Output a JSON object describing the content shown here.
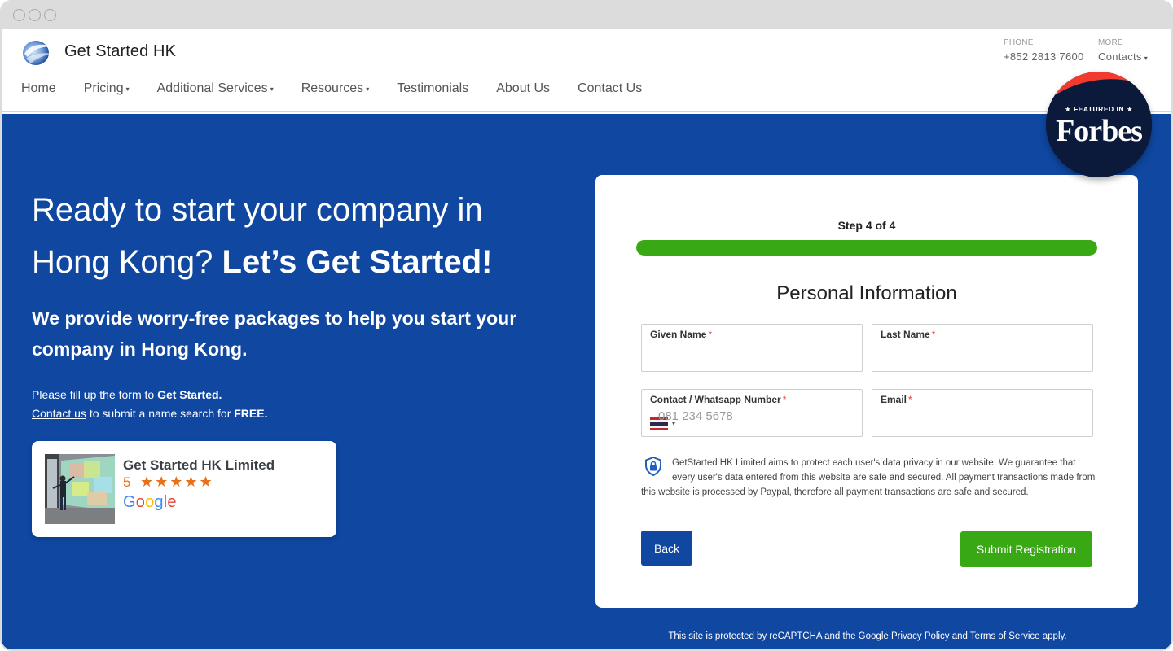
{
  "window": {
    "controls": [
      "close",
      "minimize",
      "maximize"
    ]
  },
  "header": {
    "brand": "Get Started HK",
    "logo_icon": "globe-swoosh-logo",
    "nav": [
      {
        "label": "Home",
        "dropdown": false
      },
      {
        "label": "Pricing",
        "dropdown": true
      },
      {
        "label": "Additional Services",
        "dropdown": true
      },
      {
        "label": "Resources",
        "dropdown": true
      },
      {
        "label": "Testimonials",
        "dropdown": false
      },
      {
        "label": "About Us",
        "dropdown": false
      },
      {
        "label": "Contact Us",
        "dropdown": false
      }
    ],
    "caret": "▾",
    "phone": {
      "label": "PHONE",
      "value": "+852 2813 7600"
    },
    "more": {
      "label": "MORE",
      "value": "Contacts"
    }
  },
  "badge": {
    "top": "★ FEATURED IN ★",
    "word": "Forbes"
  },
  "hero": {
    "headline_regular": "Ready to start your company in Hong Kong?",
    "headline_bold": "Let’s Get Started!",
    "subheadline": "We provide worry-free packages to help you start your company in Hong Kong.",
    "note1_prefix": "Please fill up the form to ",
    "note1_bold": "Get Started.",
    "note2_link": "Contact us",
    "note2_mid": " to submit a name search for ",
    "note2_bold": "FREE."
  },
  "review": {
    "name": "Get Started HK Limited",
    "rating": "5",
    "stars": "★★★★★",
    "rating_value": 5,
    "rating_max": 5,
    "source": "Google"
  },
  "form": {
    "step_label": "Step 4 of 4",
    "progress_fraction": 1.0,
    "title": "Personal Information",
    "fields": {
      "given_name": {
        "label": "Given Name",
        "required": "*",
        "value": ""
      },
      "last_name": {
        "label": "Last Name",
        "required": "*",
        "value": ""
      },
      "contact": {
        "label": "Contact / Whatsapp Number",
        "required": "*",
        "placeholder": "081 234 5678",
        "country": "Thailand"
      },
      "email": {
        "label": "Email",
        "required": "*",
        "value": ""
      }
    },
    "privacy_text": "GetStarted HK Limited aims to protect each user's data privacy in our website. We guarantee that every user's data entered from this website are safe and secured. All payment transactions made from this website is processed by Paypal, therefore all payment transactions are safe and secured.",
    "back_label": "Back",
    "submit_label": "Submit Registration",
    "colors": {
      "primary": "#0f47a1",
      "success": "#38a814",
      "required": "#e53935"
    }
  },
  "footer": {
    "prefix": "This site is protected by reCAPTCHA and the Google ",
    "privacy_link": "Privacy Policy",
    "mid": " and ",
    "terms_link": "Terms of Service",
    "suffix": " apply."
  }
}
